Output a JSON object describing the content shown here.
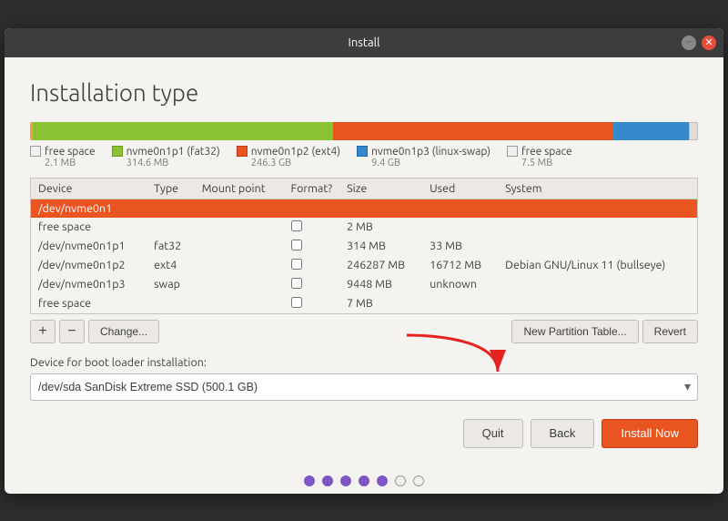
{
  "window": {
    "title": "Install"
  },
  "page": {
    "title": "Installation type"
  },
  "disk_bar": {
    "segments": [
      {
        "color": "#f0a040",
        "width_pct": 0.4,
        "label": "free space"
      },
      {
        "color": "#8ac234",
        "width_pct": 45,
        "label": "nvme0n1p1 (fat32)"
      },
      {
        "color": "#e95420",
        "width_pct": 42,
        "label": "nvme0n1p2 (ext4)"
      },
      {
        "color": "#3589cc",
        "width_pct": 11,
        "label": "nvme0n1p3 (linux-swap)"
      },
      {
        "color": "#f0f0f0",
        "width_pct": 1.2,
        "label": "free space"
      }
    ]
  },
  "legend": [
    {
      "label": "free space",
      "size": "2.1 MB",
      "color": "#f0f0f0",
      "border": "#999"
    },
    {
      "label": "nvme0n1p1 (fat32)",
      "size": "314.6 MB",
      "color": "#8ac234",
      "border": "#6a9a14"
    },
    {
      "label": "nvme0n1p2 (ext4)",
      "size": "246.3 GB",
      "color": "#e95420",
      "border": "#c0391b"
    },
    {
      "label": "nvme0n1p3 (linux-swap)",
      "size": "9.4 GB",
      "color": "#3589cc",
      "border": "#1a69ac"
    },
    {
      "label": "free space",
      "size": "7.5 MB",
      "color": "#f0f0f0",
      "border": "#999"
    }
  ],
  "table": {
    "columns": [
      "Device",
      "Type",
      "Mount point",
      "Format?",
      "Size",
      "Used",
      "System"
    ],
    "rows": [
      {
        "device": "/dev/nvme0n1",
        "type": "",
        "mount": "",
        "format": false,
        "size": "",
        "used": "",
        "system": "",
        "selected": true
      },
      {
        "device": "free space",
        "type": "",
        "mount": "",
        "format": false,
        "size": "2 MB",
        "used": "",
        "system": "",
        "selected": false
      },
      {
        "device": "/dev/nvme0n1p1",
        "type": "fat32",
        "mount": "",
        "format": false,
        "size": "314 MB",
        "used": "33 MB",
        "system": "",
        "selected": false
      },
      {
        "device": "/dev/nvme0n1p2",
        "type": "ext4",
        "mount": "",
        "format": false,
        "size": "246287 MB",
        "used": "16712 MB",
        "system": "Debian GNU/Linux 11 (bullseye)",
        "selected": false
      },
      {
        "device": "/dev/nvme0n1p3",
        "type": "swap",
        "mount": "",
        "format": false,
        "size": "9448 MB",
        "used": "unknown",
        "system": "",
        "selected": false
      },
      {
        "device": "free space",
        "type": "",
        "mount": "",
        "format": false,
        "size": "7 MB",
        "used": "",
        "system": "",
        "selected": false
      }
    ]
  },
  "actions": {
    "add_label": "+",
    "remove_label": "−",
    "change_label": "Change...",
    "new_partition_table_label": "New Partition Table...",
    "revert_label": "Revert"
  },
  "bootloader": {
    "label": "Device for boot loader installation:",
    "value": "/dev/sda          SanDisk Extreme SSD (500.1 GB)"
  },
  "footer": {
    "quit_label": "Quit",
    "back_label": "Back",
    "install_label": "Install Now"
  },
  "dots": [
    {
      "filled": true
    },
    {
      "filled": true
    },
    {
      "filled": true
    },
    {
      "filled": true
    },
    {
      "filled": true
    },
    {
      "filled": false
    },
    {
      "filled": false
    }
  ]
}
